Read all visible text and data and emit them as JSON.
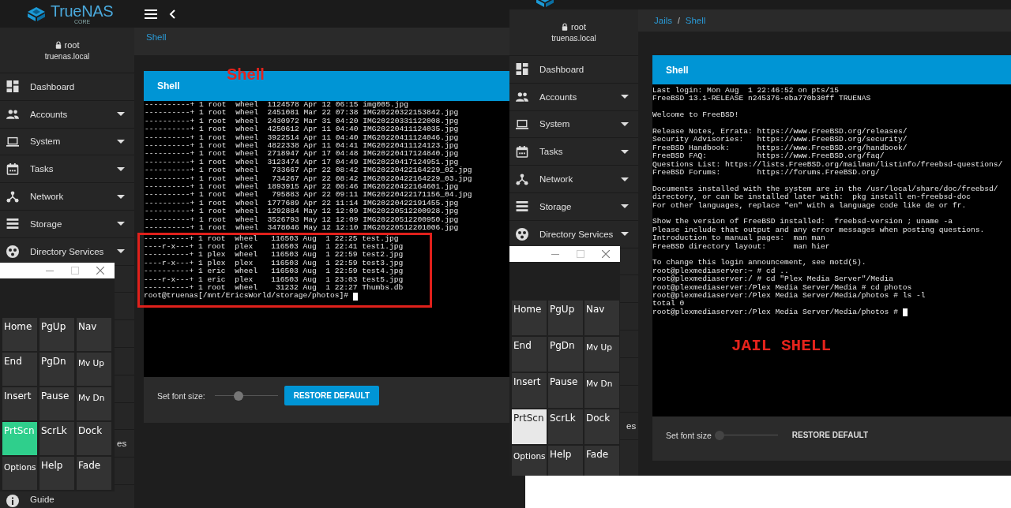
{
  "panels": [
    {
      "top_bar": {
        "brand": "TrueNAS",
        "edition": "CORE"
      },
      "sidebar": {
        "user": "root",
        "host": "truenas.local",
        "items": [
          {
            "label": "Dashboard",
            "expandable": false
          },
          {
            "label": "Accounts",
            "expandable": true
          },
          {
            "label": "System",
            "expandable": true
          },
          {
            "label": "Tasks",
            "expandable": true
          },
          {
            "label": "Network",
            "expandable": true
          },
          {
            "label": "Storage",
            "expandable": true
          },
          {
            "label": "Directory Services",
            "expandable": true
          }
        ],
        "partial_items": [
          {
            "kind": "fragment",
            "label": "es"
          },
          {
            "kind": "item",
            "label": "Guide"
          }
        ]
      },
      "breadcrumb": [
        {
          "kind": "current",
          "label": "Shell"
        }
      ],
      "annotation": {
        "kind": "header",
        "text": "Shell"
      },
      "card": {
        "title": "Shell",
        "terminal": {
          "groups": [
            {
              "kind": "plain",
              "lines": [
                "----------+ 1 root  wheel  1124578 Apr 12 06:15 img005.jpg",
                "----------+ 1 root  wheel  2451081 Mar 22 07:38 IMG20220322153842.jpg",
                "----------+ 1 root  wheel  2430972 Mar 31 04:20 IMG20220331122008.jpg",
                "----------+ 1 root  wheel  4250612 Apr 11 04:40 IMG20220411124035.jpg",
                "----------+ 1 root  wheel  3922514 Apr 11 04:40 IMG20220411124046.jpg",
                "----------+ 1 root  wheel  4822338 Apr 11 04:41 IMG20220411124123.jpg",
                "----------+ 1 root  wheel  2718947 Apr 17 04:48 IMG20220417124840.jpg",
                "----------+ 1 root  wheel  3123474 Apr 17 04:49 IMG20220417124951.jpg",
                "----------+ 1 root  wheel   733667 Apr 22 08:42 IMG20220422164229_02.jpg",
                "----------+ 1 root  wheel   734267 Apr 22 08:42 IMG20220422164229_03.jpg",
                "----------+ 1 root  wheel  1893915 Apr 22 08:46 IMG20220422164601.jpg",
                "----------+ 1 root  wheel   795883 Apr 22 09:11 IMG20220422171156_04.jpg",
                "----------+ 1 root  wheel  1777689 Apr 22 11:14 IMG20220422191455.jpg",
                "----------+ 1 root  wheel  1292884 May 12 12:09 IMG20220512200928.jpg",
                "----------+ 1 root  wheel  3526793 May 12 12:09 IMG20220512200950.jpg",
                "----------+ 1 root  wheel  3478046 May 12 12:10 IMG20220512201006.jpg"
              ]
            },
            {
              "kind": "boxed",
              "lines": [
                "----------+ 1 root  wheel   116503 Aug  1 22:25 test.jpg",
                "----r-x---+ 1 root  plex    116503 Aug  1 22:41 test1.jpg",
                "----------+ 1 plex  wheel   116503 Aug  1 22:59 test2.jpg",
                "----r-x---+ 1 plex  plex    116503 Aug  1 22:59 test3.jpg",
                "----------+ 1 eric  wheel   116503 Aug  1 22:59 test4.jpg",
                "----r-x---+ 1 eric  plex    116503 Aug  1 23:03 test5.jpg",
                "----------+ 1 root  wheel    31232 Aug  1 22:27 Thumbs.db"
              ],
              "prompt": "root@truenas[/mnt/EricsWorld/storage/photos]# "
            }
          ]
        },
        "footer": {
          "label": "Set font size:",
          "level": 0.36,
          "button": {
            "kind": "raised",
            "label": "RESTORE DEFAULT"
          }
        }
      },
      "keyboard": {
        "keys": [
          {
            "label": "Home",
            "kind": "large",
            "pressed": false
          },
          {
            "label": "PgUp",
            "kind": "large",
            "pressed": false
          },
          {
            "label": "Nav",
            "kind": "large",
            "pressed": false
          },
          {
            "label": "End",
            "kind": "large",
            "pressed": false
          },
          {
            "label": "PgDn",
            "kind": "large",
            "pressed": false
          },
          {
            "label": "Mv Up",
            "kind": "small",
            "pressed": false
          },
          {
            "label": "Insert",
            "kind": "large",
            "pressed": false
          },
          {
            "label": "Pause",
            "kind": "large",
            "pressed": false
          },
          {
            "label": "Mv Dn",
            "kind": "small",
            "pressed": false
          },
          {
            "label": "PrtScn",
            "kind": "large",
            "pressed": true
          },
          {
            "label": "ScrLk",
            "kind": "large",
            "pressed": false
          },
          {
            "label": "Dock",
            "kind": "large",
            "pressed": false
          },
          {
            "label": "Options",
            "kind": "small",
            "pressed": false
          },
          {
            "label": "Help",
            "kind": "large",
            "pressed": false
          },
          {
            "label": "Fade",
            "kind": "large",
            "pressed": false
          }
        ]
      }
    },
    {
      "sidebar": {
        "user": "root",
        "host": "truenas.local",
        "items": [
          {
            "label": "Dashboard",
            "expandable": false
          },
          {
            "label": "Accounts",
            "expandable": true
          },
          {
            "label": "System",
            "expandable": true
          },
          {
            "label": "Tasks",
            "expandable": true
          },
          {
            "label": "Network",
            "expandable": true
          },
          {
            "label": "Storage",
            "expandable": true
          },
          {
            "label": "Directory Services",
            "expandable": true
          }
        ],
        "partial_items": [
          {
            "kind": "fragment",
            "label": "es"
          }
        ]
      },
      "breadcrumb": [
        {
          "kind": "link",
          "label": "Jails"
        },
        {
          "kind": "separator",
          "label": "/"
        },
        {
          "kind": "current",
          "label": "Shell"
        }
      ],
      "annotation": {
        "kind": "terminal",
        "text": "JAIL SHELL"
      },
      "card": {
        "title": "Shell",
        "terminal": {
          "groups": [
            {
              "kind": "paragraph",
              "lines": [
                "Last login: Mon Aug  1 22:46:52 on pts/15",
                "FreeBSD 13.1-RELEASE n245376-eba770b30ff TRUENAS"
              ]
            },
            {
              "kind": "paragraph",
              "lines": [
                "Welcome to FreeBSD!"
              ]
            },
            {
              "kind": "paragraph",
              "lines": [
                "Release Notes, Errata: https://www.FreeBSD.org/releases/",
                "Security Advisories:   https://www.FreeBSD.org/security/",
                "FreeBSD Handbook:      https://www.FreeBSD.org/handbook/",
                "FreeBSD FAQ:           https://www.FreeBSD.org/faq/",
                "Questions List: https://lists.FreeBSD.org/mailman/listinfo/freebsd-questions/",
                "FreeBSD Forums:        https://forums.FreeBSD.org/"
              ]
            },
            {
              "kind": "paragraph",
              "lines": [
                "Documents installed with the system are in the /usr/local/share/doc/freebsd/",
                "directory, or can be installed later with:  pkg install en-freebsd-doc",
                "For other languages, replace \"en\" with a language code like de or fr."
              ]
            },
            {
              "kind": "paragraph",
              "lines": [
                "Show the version of FreeBSD installed:  freebsd-version ; uname -a",
                "Please include that output and any error messages when posting questions.",
                "Introduction to manual pages:  man man",
                "FreeBSD directory layout:      man hier"
              ]
            },
            {
              "kind": "plain",
              "lines": [
                "To change this login announcement, see motd(5).",
                "root@plexmediaserver:~ # cd ..",
                "root@plexmediaserver:/ # cd \"Plex Media Server\"/Media",
                "root@plexmediaserver:/Plex Media Server/Media # cd photos",
                "root@plexmediaserver:/Plex Media Server/Media/photos # ls -l",
                "total 0"
              ],
              "prompt": "root@plexmediaserver:/Plex Media Server/Media/photos # "
            }
          ]
        },
        "footer": {
          "label": "Set font size",
          "level": 0,
          "button": {
            "kind": "flat",
            "label": "RESTORE DEFAULT"
          }
        }
      },
      "keyboard": {
        "keys": [
          {
            "label": "Home",
            "kind": "large",
            "hovered": false
          },
          {
            "label": "PgUp",
            "kind": "large",
            "hovered": false
          },
          {
            "label": "Nav",
            "kind": "large",
            "hovered": false
          },
          {
            "label": "End",
            "kind": "large",
            "hovered": false
          },
          {
            "label": "PgDn",
            "kind": "large",
            "hovered": false
          },
          {
            "label": "Mv Up",
            "kind": "small",
            "hovered": false
          },
          {
            "label": "Insert",
            "kind": "large",
            "hovered": false
          },
          {
            "label": "Pause",
            "kind": "large",
            "hovered": false
          },
          {
            "label": "Mv Dn",
            "kind": "small",
            "hovered": false
          },
          {
            "label": "PrtScn",
            "kind": "large",
            "hovered": true
          },
          {
            "label": "ScrLk",
            "kind": "large",
            "hovered": false
          },
          {
            "label": "Dock",
            "kind": "large",
            "hovered": false
          },
          {
            "label": "Options",
            "kind": "small",
            "hovered": false
          },
          {
            "label": "Help",
            "kind": "large",
            "hovered": false
          },
          {
            "label": "Fade",
            "kind": "large",
            "hovered": false
          }
        ]
      }
    }
  ]
}
